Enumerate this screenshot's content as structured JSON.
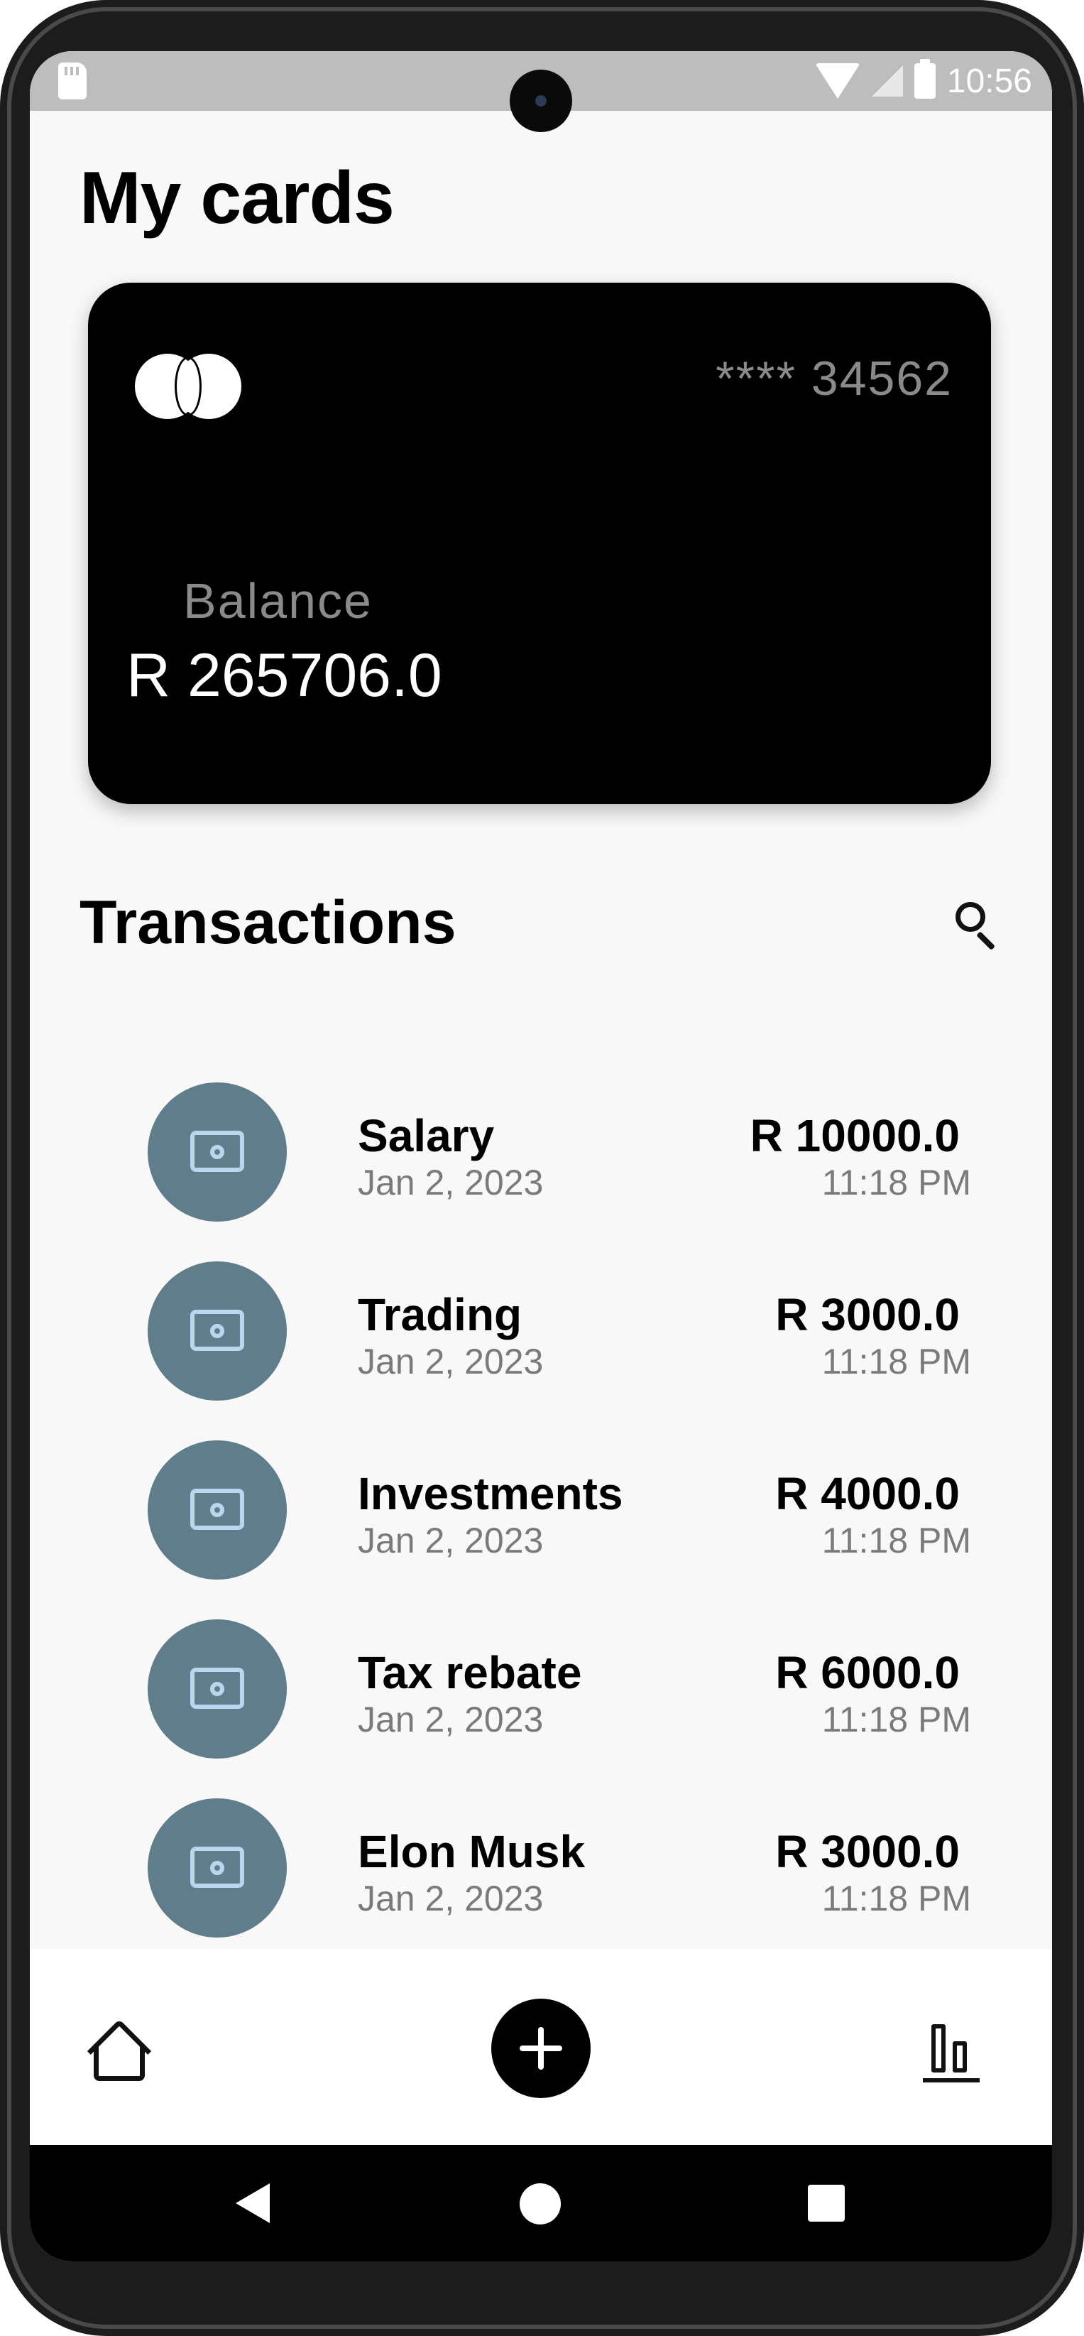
{
  "statusbar": {
    "time": "10:56"
  },
  "page": {
    "title": "My cards"
  },
  "card": {
    "number": "**** 34562",
    "balance_label": "Balance",
    "balance": "R 265706.0"
  },
  "transactions": {
    "title": "Transactions",
    "items": [
      {
        "name": "Salary",
        "date": "Jan 2, 2023",
        "amount": "R 10000.0",
        "time": "11:18 PM"
      },
      {
        "name": "Trading",
        "date": "Jan 2, 2023",
        "amount": "R 3000.0",
        "time": "11:18 PM"
      },
      {
        "name": "Investments",
        "date": "Jan 2, 2023",
        "amount": "R 4000.0",
        "time": "11:18 PM"
      },
      {
        "name": "Tax rebate",
        "date": "Jan 2, 2023",
        "amount": "R 6000.0",
        "time": "11:18 PM"
      },
      {
        "name": "Elon Musk",
        "date": "Jan 2, 2023",
        "amount": "R 3000.0",
        "time": "11:18 PM"
      }
    ]
  },
  "icons": {
    "search": "search-icon",
    "transaction": "money-bill-icon",
    "home": "home-icon",
    "add": "plus-icon",
    "stats": "bar-chart-icon",
    "card_brand": "mastercard-logo-icon"
  },
  "colors": {
    "card_bg": "#000000",
    "avatar_bg": "#607d8b",
    "avatar_icon": "#b9d6ee",
    "page_bg": "#f8f8f8",
    "status_bar": "#bdbdbd"
  }
}
